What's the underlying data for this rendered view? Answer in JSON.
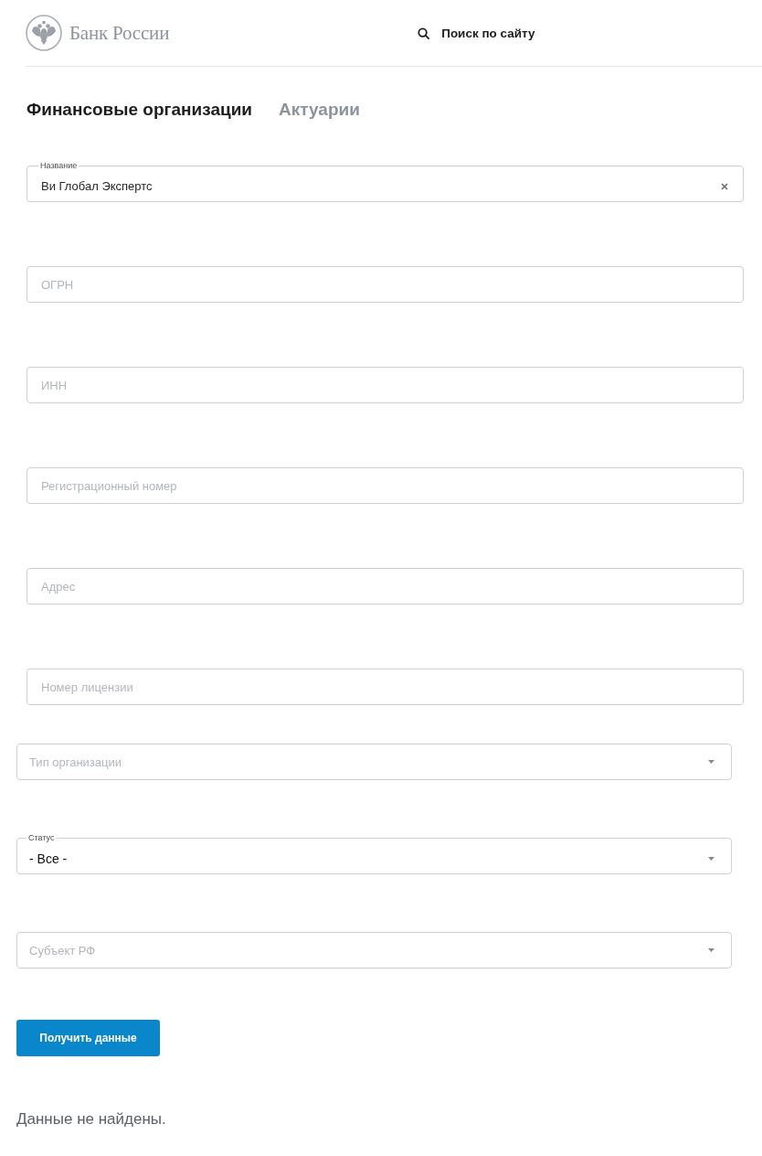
{
  "header": {
    "logo_text": "Банк России",
    "search_label": "Поиск по сайту"
  },
  "tabs": [
    {
      "label": "Финансовые организации",
      "selected": true
    },
    {
      "label": "Актуарии",
      "selected": false
    }
  ],
  "text_fields": [
    {
      "label": "Название",
      "value": "Ви Глобал Экспертс"
    },
    {
      "placeholder": "ОГРН"
    },
    {
      "placeholder": "ИНН"
    },
    {
      "placeholder": "Регистрационный номер"
    },
    {
      "placeholder": "Адрес"
    },
    {
      "placeholder": "Номер лицензии"
    }
  ],
  "dropdowns": [
    {
      "placeholder": "Тип организации"
    },
    {
      "label": "Статус",
      "value": "- Все -"
    },
    {
      "placeholder": "Субъект РФ"
    }
  ],
  "submit_button": {
    "label": "Получить данные"
  },
  "message": "Данные не найдены."
}
